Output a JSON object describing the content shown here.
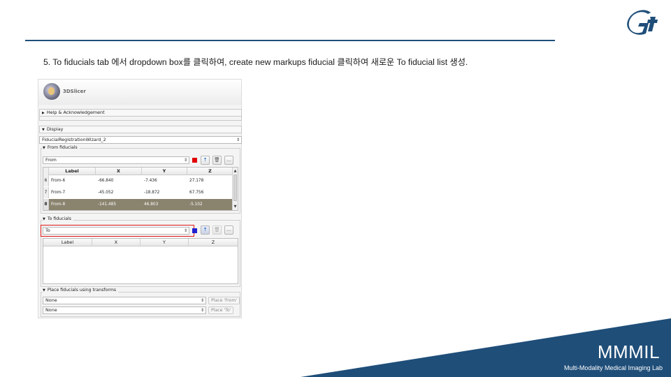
{
  "slide": {
    "instruction": "5. To fiducials tab 에서 dropdown box를 클릭하여, create new markups fiducial 클릭하여 새로운 To fiducial list 생성.",
    "footer_title": "MMMIL",
    "footer_subtitle": "Multi-Modality Medical Imaging Lab",
    "colors": {
      "rule": "#1f4e79",
      "footer": "#1f4e79",
      "logo": "#1f4e79"
    },
    "logo_icon": "gi-logo-icon"
  },
  "panel": {
    "brand": "3DSlicer",
    "help_section": "Help & Acknowledgement",
    "display_section": "Display",
    "module_selector": "FiducialRegistrationWizard_2",
    "from_fiducials": {
      "title": "From fiducials",
      "list_selector": "From",
      "color": "#e00000",
      "columns": [
        "Label",
        "X",
        "Y",
        "Z"
      ],
      "rows": [
        {
          "index": "6",
          "label": "From-6",
          "x": "-66.840",
          "y": "-7.436",
          "z": "27.178"
        },
        {
          "index": "7",
          "label": "From-7",
          "x": "-45.052",
          "y": "-18.872",
          "z": "67.756"
        },
        {
          "index": "8",
          "label": "From-8",
          "x": "-141.485",
          "y": "46.803",
          "z": "-5.102"
        }
      ],
      "selected_row": "8"
    },
    "to_fiducials": {
      "title": "To fiducials",
      "list_selector": "To",
      "color": "#2020d0",
      "columns": [
        "Label",
        "X",
        "Y",
        "Z"
      ],
      "rows": []
    },
    "place_section": {
      "title": "Place fiducials using transforms",
      "from_transform": "None",
      "to_transform": "None",
      "place_from_label": "Place 'From'",
      "place_to_label": "Place 'To'"
    },
    "icons": {
      "place": "place-fiducial-icon",
      "delete": "delete-icon",
      "more": "more-options-icon",
      "expanded": "triangle-down-icon",
      "collapsed": "triangle-right-icon",
      "dropdown": "dropdown-arrows-icon"
    }
  }
}
